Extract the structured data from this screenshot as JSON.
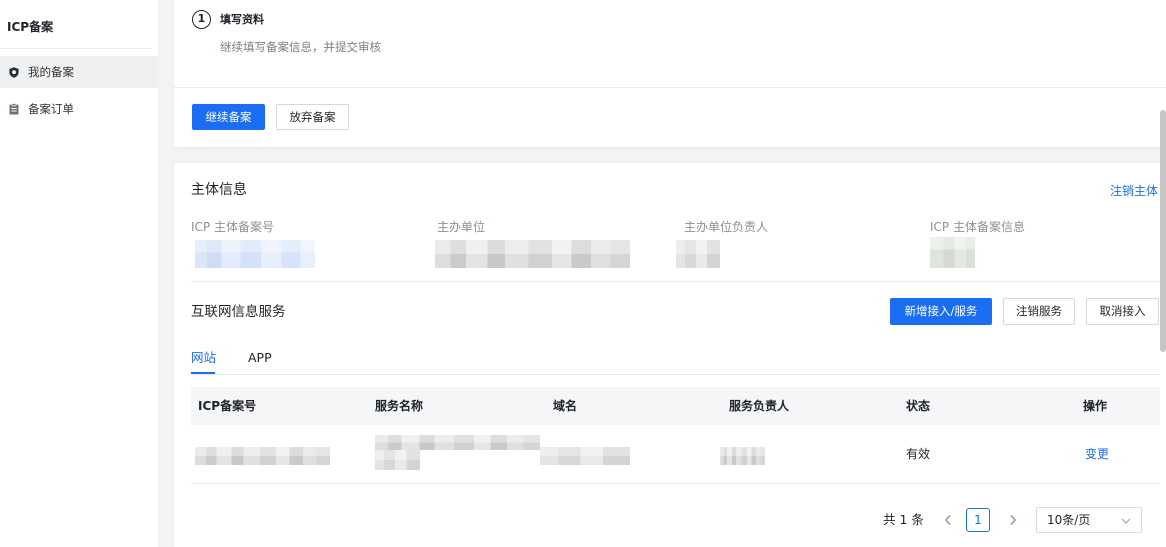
{
  "colors": {
    "primary": "#1b6ef3",
    "link": "#1b6ef3",
    "page_bg": "#f2f3f5",
    "text": "#1f2329",
    "muted": "#8a8f99"
  },
  "sidebar": {
    "title": "ICP备案",
    "items": [
      {
        "label": "我的备案",
        "icon": "shield-icon",
        "active": true
      },
      {
        "label": "备案订单",
        "icon": "clipboard-icon",
        "active": false
      }
    ]
  },
  "step": {
    "number": "1",
    "title": "填写资料",
    "description": "继续填写备案信息，并提交审核",
    "actions": {
      "continue": "继续备案",
      "abandon": "放弃备案"
    }
  },
  "entity": {
    "title": "主体信息",
    "cancel_link": "注销主体",
    "fields": [
      {
        "label": "ICP 主体备案号"
      },
      {
        "label": "主办单位"
      },
      {
        "label": "主办单位负责人"
      },
      {
        "label": "ICP 主体备案信息"
      }
    ]
  },
  "service": {
    "title": "互联网信息服务",
    "actions": {
      "add": "新增接入/服务",
      "cancel_service": "注销服务",
      "cancel_access": "取消接入"
    },
    "tabs": [
      {
        "label": "网站",
        "active": true
      },
      {
        "label": "APP",
        "active": false
      }
    ],
    "table": {
      "columns": [
        "ICP备案号",
        "服务名称",
        "域名",
        "服务负责人",
        "状态",
        "操作"
      ],
      "rows": [
        {
          "status": "有效",
          "action": "变更"
        }
      ]
    }
  },
  "pagination": {
    "total": "共 1 条",
    "current_page": "1",
    "page_size": "10条/页",
    "prev_icon": "chevron-left-icon",
    "next_icon": "chevron-right-icon",
    "dropdown_icon": "chevron-down-icon"
  }
}
